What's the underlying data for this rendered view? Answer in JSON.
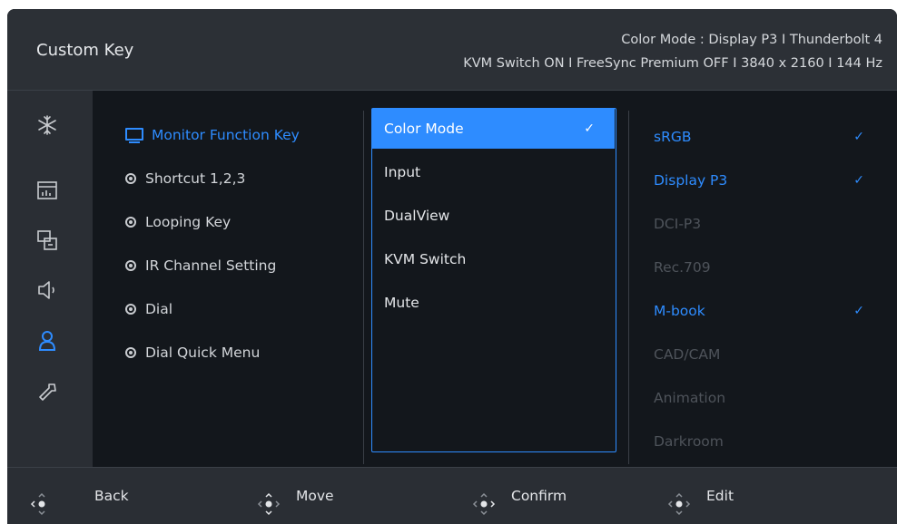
{
  "header": {
    "title": "Custom Key",
    "status_line1": "Color Mode : Display P3  I  Thunderbolt 4",
    "status_line2": "KVM Switch ON  I  FreeSync Premium OFF  I  3840 x 2160  I  144 Hz"
  },
  "sidebar": {
    "icons": [
      "snowflake-icon",
      "picture-icon",
      "pip-icon",
      "speaker-icon",
      "user-icon",
      "wrench-icon"
    ],
    "active": "user-icon"
  },
  "menu": {
    "items": [
      {
        "label": "Monitor Function Key",
        "active": true
      },
      {
        "label": "Shortcut 1,2,3",
        "active": false
      },
      {
        "label": "Looping Key",
        "active": false
      },
      {
        "label": "IR Channel Setting",
        "active": false
      },
      {
        "label": "Dial",
        "active": false
      },
      {
        "label": "Dial Quick Menu",
        "active": false
      }
    ]
  },
  "functions": {
    "items": [
      {
        "label": "Color Mode",
        "selected": true
      },
      {
        "label": "Input",
        "selected": false
      },
      {
        "label": "DualView",
        "selected": false
      },
      {
        "label": "KVM Switch",
        "selected": false
      },
      {
        "label": "Mute",
        "selected": false
      }
    ],
    "check_glyph": "✓"
  },
  "values": {
    "items": [
      {
        "label": "sRGB",
        "enabled": true,
        "checked": true
      },
      {
        "label": "Display P3",
        "enabled": true,
        "checked": true
      },
      {
        "label": "DCI-P3",
        "enabled": false,
        "checked": false
      },
      {
        "label": "Rec.709",
        "enabled": false,
        "checked": false
      },
      {
        "label": "M-book",
        "enabled": true,
        "checked": true
      },
      {
        "label": "CAD/CAM",
        "enabled": false,
        "checked": false
      },
      {
        "label": "Animation",
        "enabled": false,
        "checked": false
      },
      {
        "label": "Darkroom",
        "enabled": false,
        "checked": false
      }
    ]
  },
  "footer": {
    "back": "Back",
    "move": "Move",
    "confirm": "Confirm",
    "edit": "Edit"
  },
  "colors": {
    "accent": "#2e8cff",
    "panel": "#13171c",
    "bar": "#2a2e34"
  }
}
